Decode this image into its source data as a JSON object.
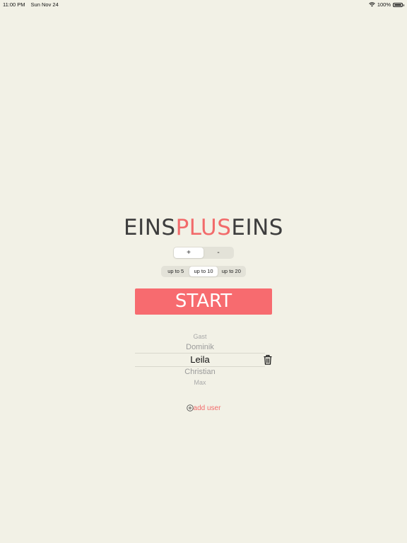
{
  "status_bar": {
    "time": "11:00 PM",
    "date": "Sun Nov 24",
    "battery": "100%",
    "battery_level": 1.0,
    "icons": [
      "wifi-icon",
      "battery-icon"
    ]
  },
  "title": {
    "part1": "EINS",
    "part2": "PLUS",
    "part3": "EINS"
  },
  "operation_selector": {
    "options": [
      "+",
      "-"
    ],
    "selected_index": 0
  },
  "range_selector": {
    "options": [
      "up to 5",
      "up to 10",
      "up to 20"
    ],
    "selected_index": 1
  },
  "start_button": {
    "label": "START"
  },
  "user_picker": {
    "items": [
      "Gast",
      "Dominik",
      "Leila",
      "Christian",
      "Max"
    ],
    "selected": "Leila"
  },
  "add_user": {
    "label": "add user",
    "icon": "plus-circle-icon"
  },
  "colors": {
    "background": "#f2f1e6",
    "accent": "#f76b6f",
    "title_dark": "#3d3d3d"
  }
}
